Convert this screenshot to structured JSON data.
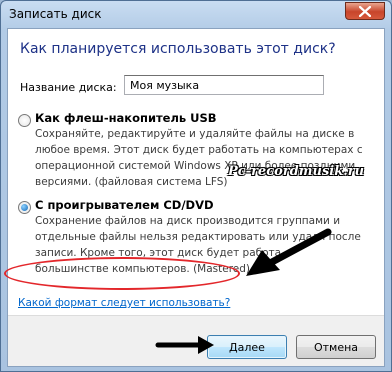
{
  "window": {
    "title": "Записать диск",
    "close_icon": "close-icon"
  },
  "heading": "Как планируется использовать этот диск?",
  "disc_name": {
    "label": "Название диска:",
    "value": "Моя музыка"
  },
  "options": [
    {
      "title": "Как флеш-накопитель USB",
      "selected": false,
      "desc_lines": [
        "Сохраняйте, редактируйте и удаляйте файлы на диске в",
        "любое время. Этот диск будет работать на компьютерах с",
        "операционной системой Windows XP или более поздними",
        "версиями. (файловая система LFS)"
      ]
    },
    {
      "title": "С проигрывателем CD/DVD",
      "selected": true,
      "desc_lines": [
        "Сохранение файлов на диск производится группами и",
        "отдельные файлы нельзя редактировать или удаля после",
        "записи. Кроме того, этот диск будет работа",
        "большинстве компьютеров. (Mastered)"
      ]
    }
  ],
  "help_link": "Какой формат следует использовать?",
  "buttons": {
    "next": "Далее",
    "cancel": "Отмена"
  },
  "watermark": "Pc-recordmusik.ru",
  "colors": {
    "heading": "#1e3287",
    "link": "#0066cc",
    "annotation": "#e3272b"
  }
}
